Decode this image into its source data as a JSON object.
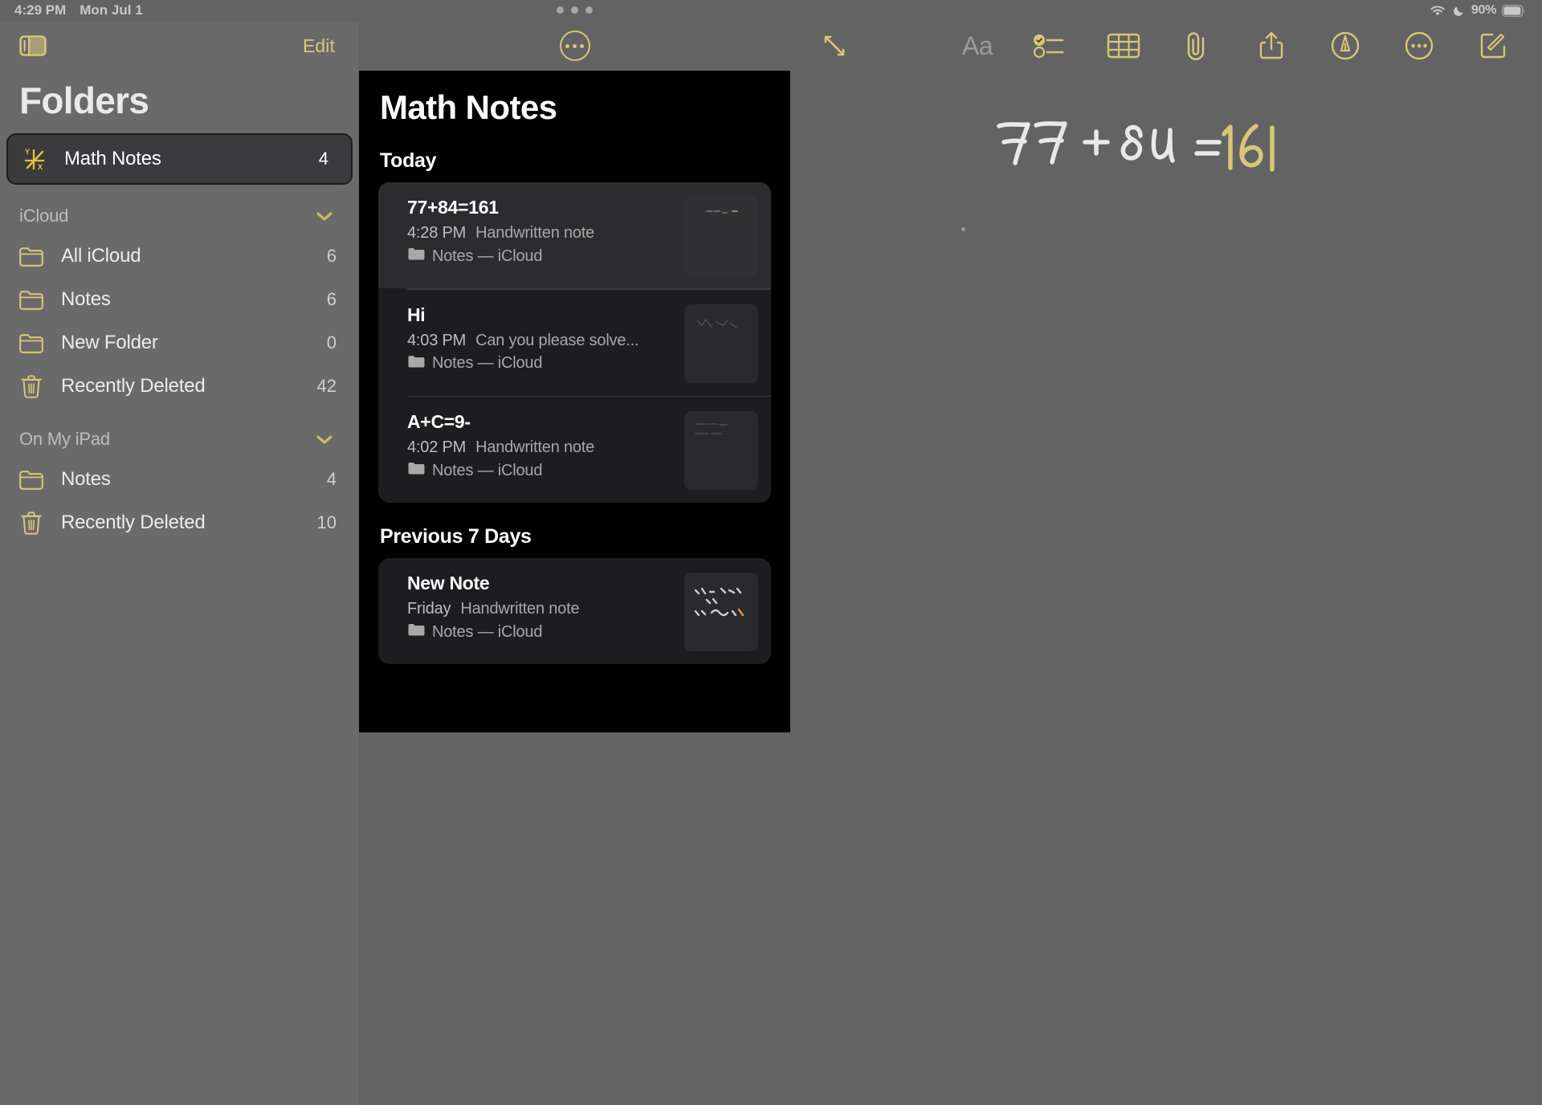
{
  "status_bar": {
    "time": "4:29 PM",
    "date": "Mon Jul 1",
    "battery_percent": "90%",
    "icons": [
      "wifi-icon",
      "moon-icon",
      "battery-icon"
    ]
  },
  "sidebar": {
    "toggle_icon": "sidebar-toggle-icon",
    "edit_label": "Edit",
    "title": "Folders",
    "pinned": {
      "label": "Math Notes",
      "count": "4",
      "icon": "math-graph-icon",
      "selected": true
    },
    "sections": [
      {
        "label": "iCloud",
        "chevron": "chevron-down-icon",
        "items": [
          {
            "label": "All iCloud",
            "count": "6",
            "icon": "folder-icon"
          },
          {
            "label": "Notes",
            "count": "6",
            "icon": "folder-icon"
          },
          {
            "label": "New Folder",
            "count": "0",
            "icon": "folder-icon"
          },
          {
            "label": "Recently Deleted",
            "count": "42",
            "icon": "trash-icon"
          }
        ]
      },
      {
        "label": "On My iPad",
        "chevron": "chevron-down-icon",
        "items": [
          {
            "label": "Notes",
            "count": "4",
            "icon": "folder-icon"
          },
          {
            "label": "Recently Deleted",
            "count": "10",
            "icon": "trash-icon"
          }
        ]
      }
    ]
  },
  "notes_panel": {
    "more_button_icon": "more-circle-icon",
    "grabber_icon": "multitask-grabber-icon",
    "title": "Math Notes",
    "groups": [
      {
        "heading": "Today",
        "notes": [
          {
            "title": "77+84=161",
            "time": "4:28 PM",
            "preview": "Handwritten note",
            "folder": "Notes — iCloud",
            "active": true
          },
          {
            "title": "Hi",
            "time": "4:03 PM",
            "preview": "Can you please solve...",
            "folder": "Notes — iCloud",
            "active": false
          },
          {
            "title": "A+C=9-",
            "time": "4:02 PM",
            "preview": "Handwritten note",
            "folder": "Notes — iCloud",
            "active": false
          }
        ]
      },
      {
        "heading": "Previous 7 Days",
        "notes": [
          {
            "title": "New Note",
            "time": "Friday",
            "preview": "Handwritten note",
            "folder": "Notes — iCloud",
            "active": false
          }
        ]
      }
    ]
  },
  "editor": {
    "expand_icon": "expand-arrows-icon",
    "format_label": "Aa",
    "toolbar_icons": [
      "checklist-icon",
      "table-icon",
      "paperclip-icon",
      "share-icon",
      "markup-pen-icon",
      "more-circle-icon",
      "compose-icon"
    ],
    "handwriting": {
      "expression": "77 + 84 =",
      "result": "161",
      "result_color": "#d8c678",
      "ink_color": "#e8e8e8"
    }
  }
}
